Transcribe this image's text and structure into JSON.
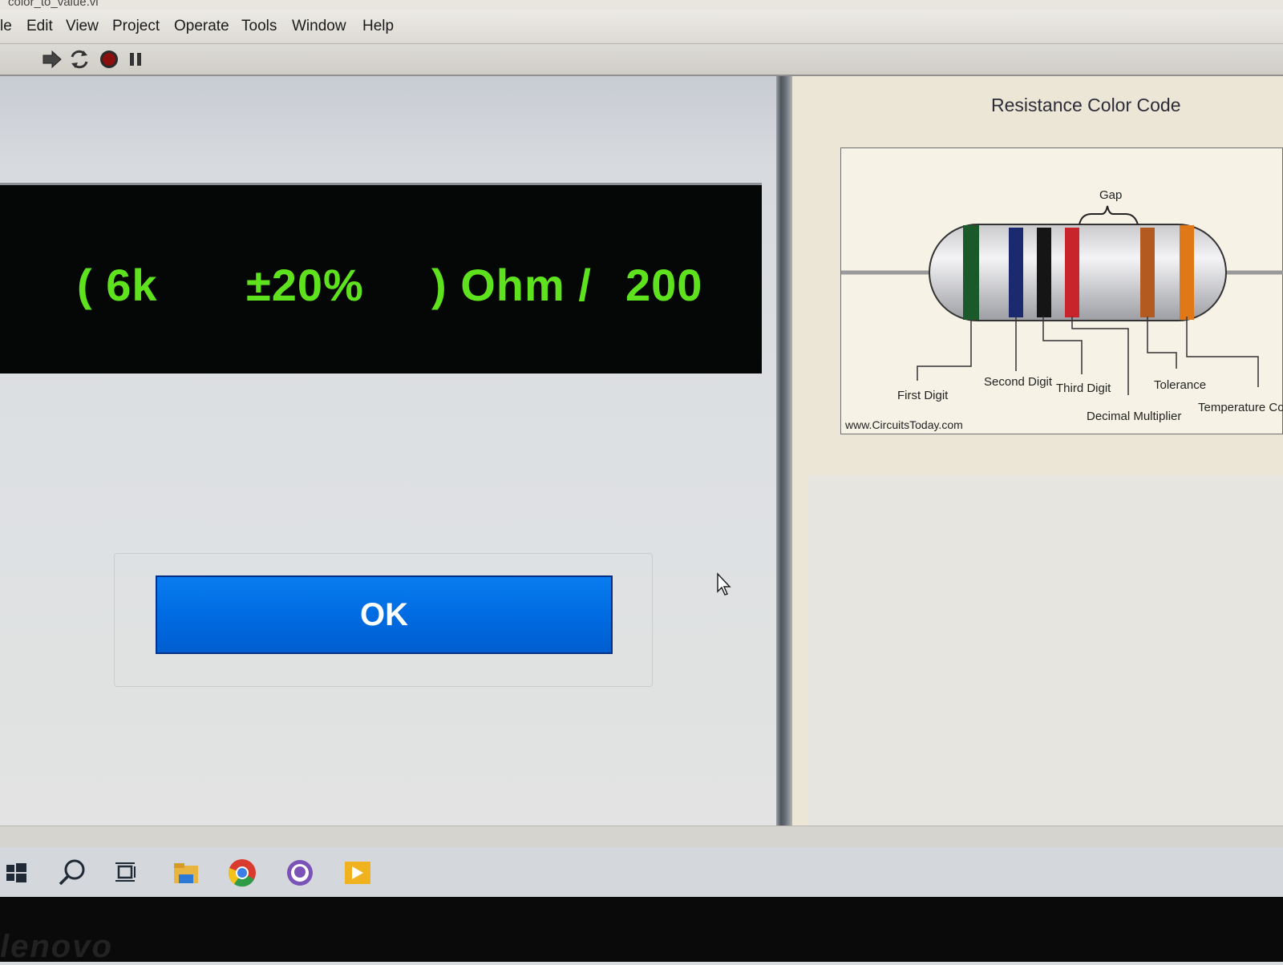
{
  "window": {
    "title": "color_to_value.vi"
  },
  "menu": [
    "le",
    "Edit",
    "View",
    "Project",
    "Operate",
    "Tools",
    "Window",
    "Help"
  ],
  "toolbar": {
    "icons": [
      "run-arrow-icon",
      "run-continuously-icon",
      "abort-stop-icon",
      "pause-icon"
    ]
  },
  "display": {
    "value": "( 6k",
    "tolerance": "±20%",
    "unit": ") Ohm /",
    "count": "200",
    "text_color": "#5fe21e",
    "background": "#050606"
  },
  "ok_button": {
    "label": "OK",
    "color": "#0a7cf0"
  },
  "resistor_chart": {
    "title": "Resistance Color Code",
    "labels": {
      "gap": "Gap",
      "first_digit": "First Digit",
      "second_digit": "Second Digit",
      "third_digit": "Third Digit",
      "tolerance": "Tolerance",
      "decimal_multiplier": "Decimal Multiplier",
      "temperature": "Temperature Coeff",
      "source": "www.CircuitsToday.com"
    },
    "band_colors": [
      "#1a5a2a",
      "#1b2a6e",
      "#151515",
      "#c7252b",
      "#b35a20",
      "#e07818"
    ]
  },
  "taskbar": {
    "icons": [
      "windows-start-icon",
      "search-icon",
      "task-view-icon",
      "file-explorer-icon",
      "chrome-icon",
      "github-desktop-icon",
      "media-player-icon"
    ]
  },
  "bezel": {
    "brand": "lenovo"
  }
}
